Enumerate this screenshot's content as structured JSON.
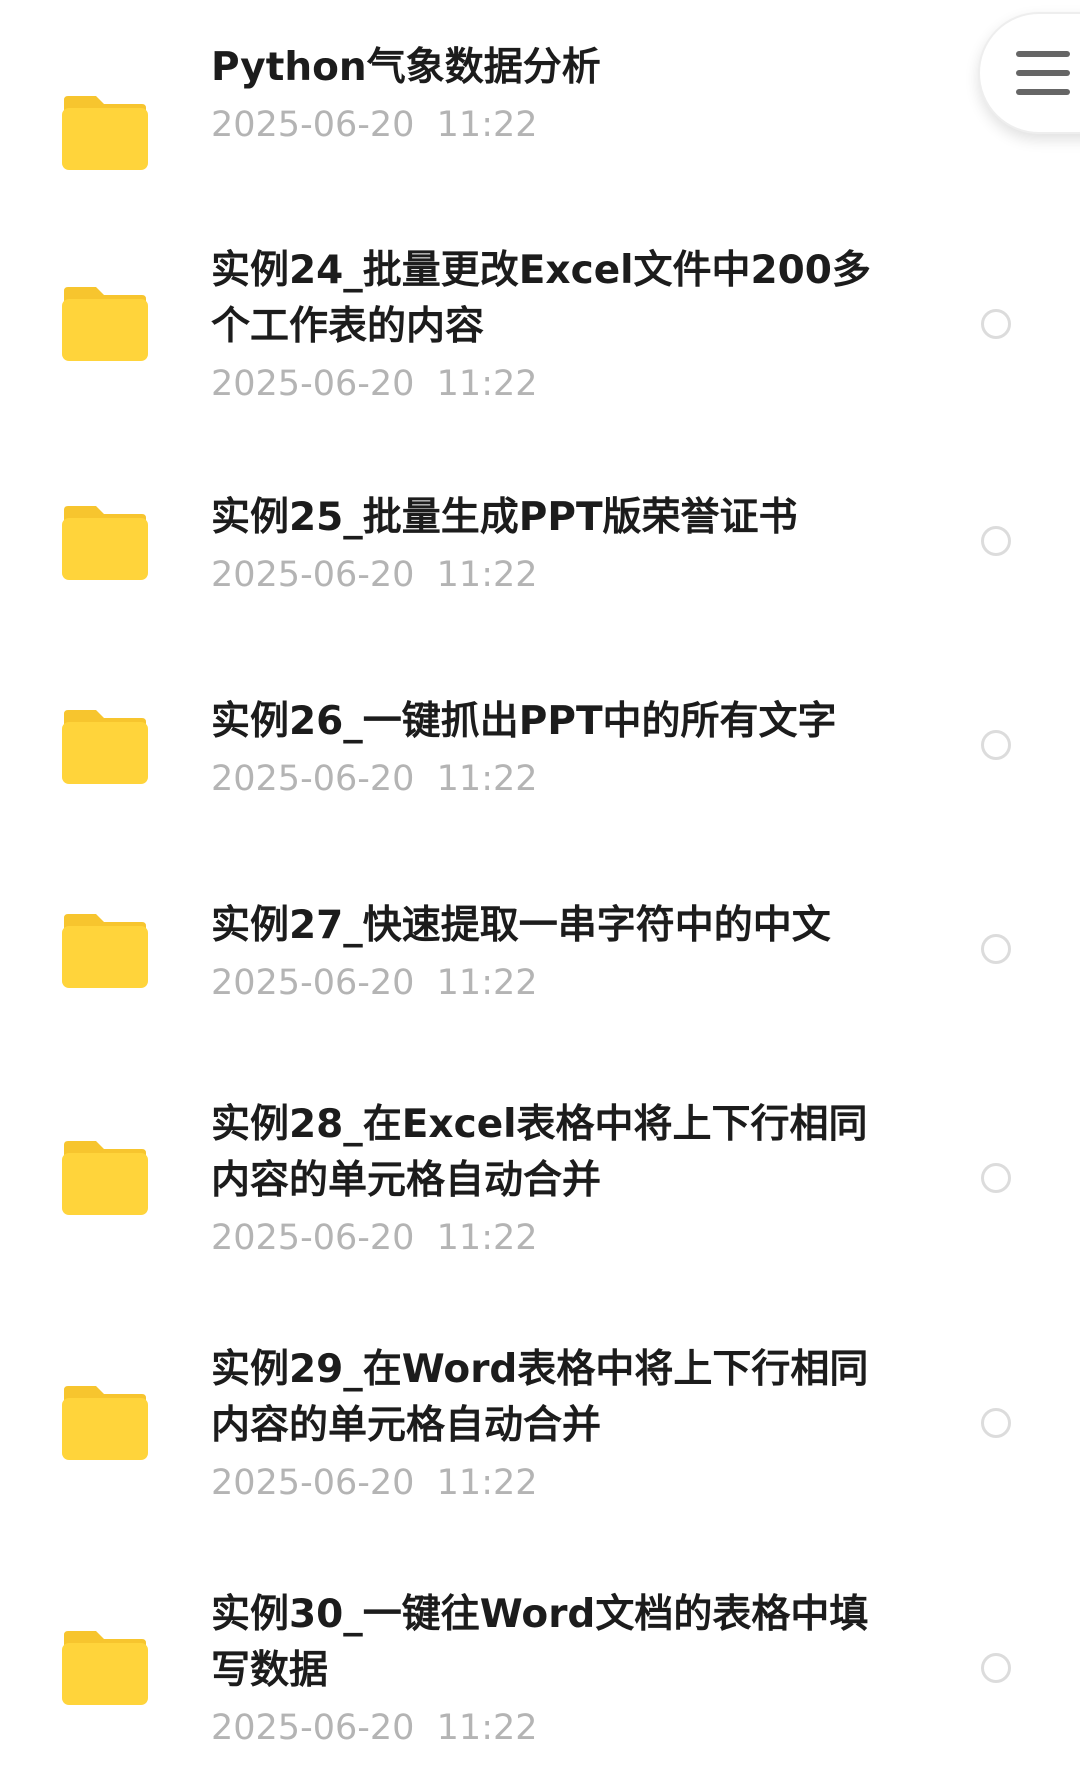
{
  "files": [
    {
      "name": "Python气象数据分析",
      "date": "2025-06-20  11:22"
    },
    {
      "name": "实例24_批量更改Excel文件中200多个工作表的内容",
      "date": "2025-06-20  11:22"
    },
    {
      "name": "实例25_批量生成PPT版荣誉证书",
      "date": "2025-06-20  11:22"
    },
    {
      "name": "实例26_一键抓出PPT中的所有文字",
      "date": "2025-06-20  11:22"
    },
    {
      "name": "实例27_快速提取一串字符中的中文",
      "date": "2025-06-20  11:22"
    },
    {
      "name": "实例28_在Excel表格中将上下行相同内容的单元格自动合并",
      "date": "2025-06-20  11:22"
    },
    {
      "name": "实例29_在Word表格中将上下行相同内容的单元格自动合并",
      "date": "2025-06-20  11:22"
    },
    {
      "name": "实例30_一键往Word文档的表格中填写数据",
      "date": "2025-06-20  11:22"
    }
  ],
  "icons": {
    "folder": "folder-icon",
    "menu": "menu-icon",
    "select": "select-circle"
  },
  "colors": {
    "folder_yellow": "#FFD43B",
    "folder_tab": "#F7C52E",
    "title_text": "#1C1C1C",
    "date_text": "#B4B4B4"
  }
}
